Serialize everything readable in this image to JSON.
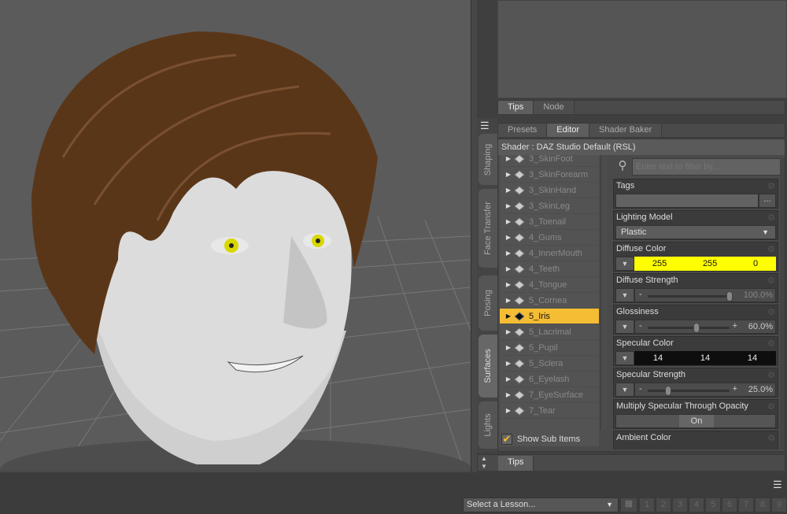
{
  "viewport": {
    "description_icon": "3d-head-model"
  },
  "side_tabs": [
    {
      "label": "Shaping"
    },
    {
      "label": "Face Transfer"
    },
    {
      "label": "Posing"
    },
    {
      "label": "Surfaces",
      "active": true
    },
    {
      "label": "Lights"
    }
  ],
  "top_tabs": [
    {
      "label": "Tips",
      "active": true
    },
    {
      "label": "Node"
    }
  ],
  "editor_tabs": [
    {
      "label": "Presets"
    },
    {
      "label": "Editor",
      "active": true
    },
    {
      "label": "Shader Baker"
    }
  ],
  "shader_label": "Shader : DAZ Studio Default (RSL)",
  "surfaces": [
    "3_SkinFoot",
    "3_SkinForearm",
    "3_SkinHand",
    "3_SkinLeg",
    "3_Toenail",
    "4_Gums",
    "4_InnerMouth",
    "4_Teeth",
    "4_Tongue",
    "5_Cornea",
    "5_Iris",
    "5_Lacrimal",
    "5_Pupil",
    "5_Sclera",
    "6_Eyelash",
    "7_EyeSurface",
    "7_Tear"
  ],
  "selected_surface": "5_Iris",
  "show_sub_items": {
    "label": "Show Sub Items",
    "checked": true
  },
  "search": {
    "placeholder": "Enter text to filter by..."
  },
  "properties": {
    "tags": {
      "label": "Tags",
      "value": "",
      "more": "..."
    },
    "lighting_model": {
      "label": "Lighting Model",
      "value": "Plastic"
    },
    "diffuse_color": {
      "label": "Diffuse Color",
      "r": "255",
      "g": "255",
      "b": "0",
      "color": "#ffff00"
    },
    "diffuse_strength": {
      "label": "Diffuse Strength",
      "value": "100.0%",
      "fraction": 1.0
    },
    "glossiness": {
      "label": "Glossiness",
      "value": "60.0%",
      "fraction": 0.6
    },
    "specular_color": {
      "label": "Specular Color",
      "r": "14",
      "g": "14",
      "b": "14",
      "color": "#0e0e0e"
    },
    "specular_strength": {
      "label": "Specular Strength",
      "value": "25.0%",
      "fraction": 0.25
    },
    "multiply_specular": {
      "label": "Multiply Specular Through Opacity",
      "value": "On"
    },
    "ambient_color": {
      "label": "Ambient Color"
    }
  },
  "bottom_tips": "Tips",
  "lesson": {
    "placeholder": "Select a Lesson..."
  },
  "lesson_steps": [
    "1",
    "2",
    "3",
    "4",
    "5",
    "6",
    "7",
    "8",
    "9"
  ],
  "colors": {
    "selection": "#f5bd33",
    "iris": "#d8d800"
  }
}
